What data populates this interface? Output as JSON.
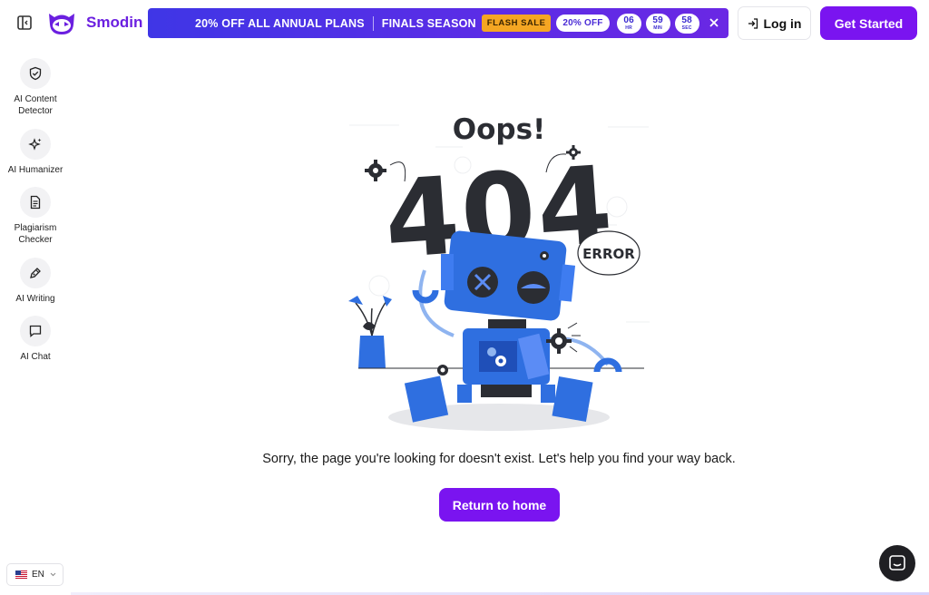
{
  "header": {
    "brand": "Smodin",
    "login_label": "Log in",
    "cta_label": "Get Started"
  },
  "promo": {
    "text_a": "20% OFF ALL ANNUAL PLANS",
    "text_b": "FINALS SEASON",
    "flash_badge": "FLASH SALE",
    "off_badge": "20% OFF",
    "timer": [
      {
        "value": "06",
        "unit": "HR"
      },
      {
        "value": "59",
        "unit": "MIN"
      },
      {
        "value": "58",
        "unit": "SEC"
      }
    ]
  },
  "sidebar": {
    "items": [
      {
        "label": "AI Content Detector",
        "icon": "shield-check-icon"
      },
      {
        "label": "AI Humanizer",
        "icon": "sparkles-icon"
      },
      {
        "label": "Plagiarism Checker",
        "icon": "document-icon"
      },
      {
        "label": "AI Writing",
        "icon": "pen-icon"
      },
      {
        "label": "AI Chat",
        "icon": "chat-icon"
      }
    ]
  },
  "language": {
    "selected": "EN"
  },
  "main": {
    "oops": "Oops!",
    "code": "404",
    "error_label": "ERROR",
    "message": "Sorry, the page you're looking for doesn't exist. Let's help you find your way back.",
    "home_button": "Return to home"
  },
  "colors": {
    "brand": "#7a14f0",
    "promo_start": "#3f36e6",
    "flash": "#f5a623",
    "robot_blue": "#2f6fe0",
    "dark_text": "#2b2d33"
  }
}
